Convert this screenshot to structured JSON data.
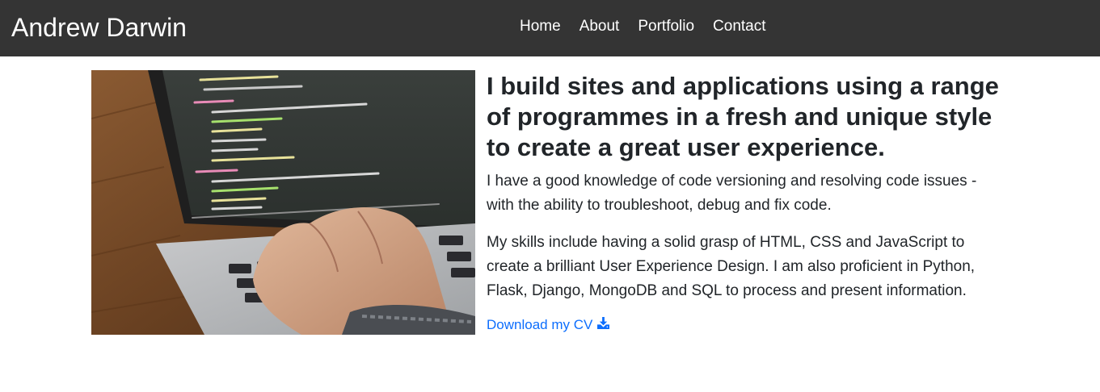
{
  "navbar": {
    "brand": "Andrew Darwin",
    "links": [
      {
        "label": "Home"
      },
      {
        "label": "About"
      },
      {
        "label": "Portfolio"
      },
      {
        "label": "Contact"
      }
    ]
  },
  "hero": {
    "image_icon": "laptop-coding-photo",
    "headline": "I build sites and applications using a range of programmes in a fresh and unique style to create a great user experience.",
    "paragraphs": [
      "I have a good knowledge of code versioning and resolving code issues - with the ability to troubleshoot, debug and fix code.",
      "My skills include having a solid grasp of HTML, CSS and JavaScript to create a brilliant User Experience Design. I am also proficient in Python, Flask, Django, MongoDB and SQL to process and present information."
    ],
    "cv_link": {
      "label": "Download my CV",
      "icon": "download-icon"
    }
  },
  "colors": {
    "navbar_bg": "#343434",
    "link": "#0d6efd",
    "text": "#212529"
  }
}
